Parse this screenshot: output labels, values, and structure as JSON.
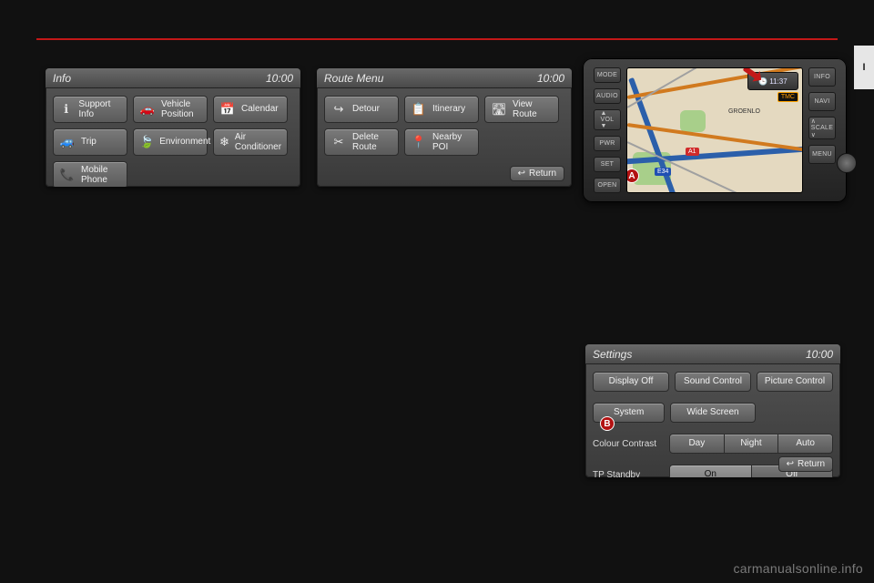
{
  "page_tab": "I",
  "info": {
    "title": "Info",
    "clock": "10:00",
    "buttons": [
      {
        "icon": "ℹ",
        "label": "Support Info",
        "name": "support-info"
      },
      {
        "icon": "🚗",
        "label": "Vehicle\nPosition",
        "name": "vehicle-position"
      },
      {
        "icon": "📅",
        "label": "Calendar",
        "name": "calendar"
      },
      {
        "icon": "🚙",
        "label": "Trip",
        "name": "trip"
      },
      {
        "icon": "🍃",
        "label": "Environment",
        "name": "environment"
      },
      {
        "icon": "❄",
        "label": "Air\nConditioner",
        "name": "air-conditioner"
      },
      {
        "icon": "📞",
        "label": "Mobile\nPhone",
        "name": "mobile-phone"
      }
    ]
  },
  "route": {
    "title": "Route Menu",
    "clock": "10:00",
    "buttons": [
      {
        "icon": "↪",
        "label": "Detour",
        "name": "detour"
      },
      {
        "icon": "📋",
        "label": "Itinerary",
        "name": "itinerary"
      },
      {
        "icon": "🛣",
        "label": "View\nRoute",
        "name": "view-route"
      },
      {
        "icon": "✂",
        "label": "Delete\nRoute",
        "name": "delete-route"
      },
      {
        "icon": "📍",
        "label": "Nearby\nPOI",
        "name": "nearby-poi"
      }
    ],
    "return": "Return"
  },
  "settings": {
    "title": "Settings",
    "clock": "10:00",
    "row1": [
      "Display Off",
      "Sound Control",
      "Picture Control"
    ],
    "row2": [
      "System",
      "Wide Screen"
    ],
    "colour_label": "Colour Contrast",
    "colour_opts": [
      "Day",
      "Night",
      "Auto"
    ],
    "tp_label": "TP Standby",
    "tp_opts": [
      "On",
      "Off"
    ],
    "return": "Return",
    "badge_b": "B"
  },
  "device": {
    "left_buttons": [
      "MODE",
      "AUDIO",
      "▲\nVOL\n▼",
      "PWR",
      "SET",
      "OPEN"
    ],
    "right_buttons": [
      "INFO",
      "NAVI",
      "∧\nSCALE\n∨",
      "MENU"
    ],
    "clock": "11:37",
    "tmc": "TMC",
    "badge_a": "A",
    "town": "GROENLO",
    "shields": [
      "E34",
      "A1"
    ]
  },
  "watermark": "carmanualsonline.info"
}
